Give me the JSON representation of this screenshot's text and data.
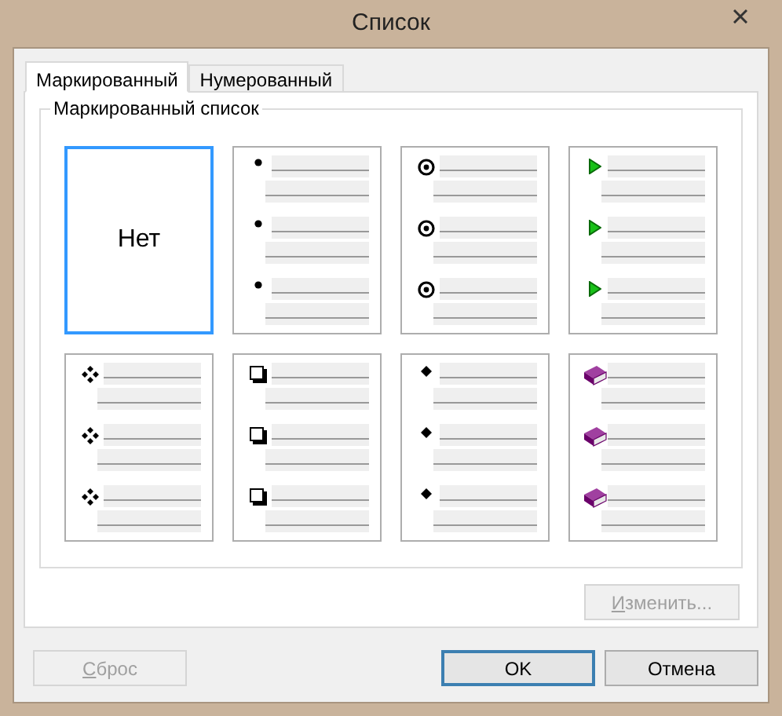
{
  "window": {
    "title": "Список"
  },
  "tabs": [
    {
      "label": "Маркированный",
      "selected": true
    },
    {
      "label": "Нумерованный",
      "selected": false
    }
  ],
  "group": {
    "title": "Маркированный список"
  },
  "bullets": [
    {
      "kind": "none",
      "label": "Нет",
      "selected": true
    },
    {
      "kind": "dot",
      "selected": false
    },
    {
      "kind": "circle",
      "selected": false
    },
    {
      "kind": "arrow",
      "selected": false
    },
    {
      "kind": "diamonds",
      "selected": false
    },
    {
      "kind": "square",
      "selected": false
    },
    {
      "kind": "diamond",
      "selected": false
    },
    {
      "kind": "book",
      "selected": false
    }
  ],
  "change_button": {
    "label": "Изменить...",
    "mnemonic_underlined": true,
    "disabled": true
  },
  "buttons": [
    {
      "label": "Сброс",
      "mnemonic_underlined": true,
      "disabled": true,
      "default": false
    },
    {
      "label": "OK",
      "disabled": false,
      "default": true
    },
    {
      "label": "Отмена",
      "disabled": false,
      "default": false
    }
  ]
}
